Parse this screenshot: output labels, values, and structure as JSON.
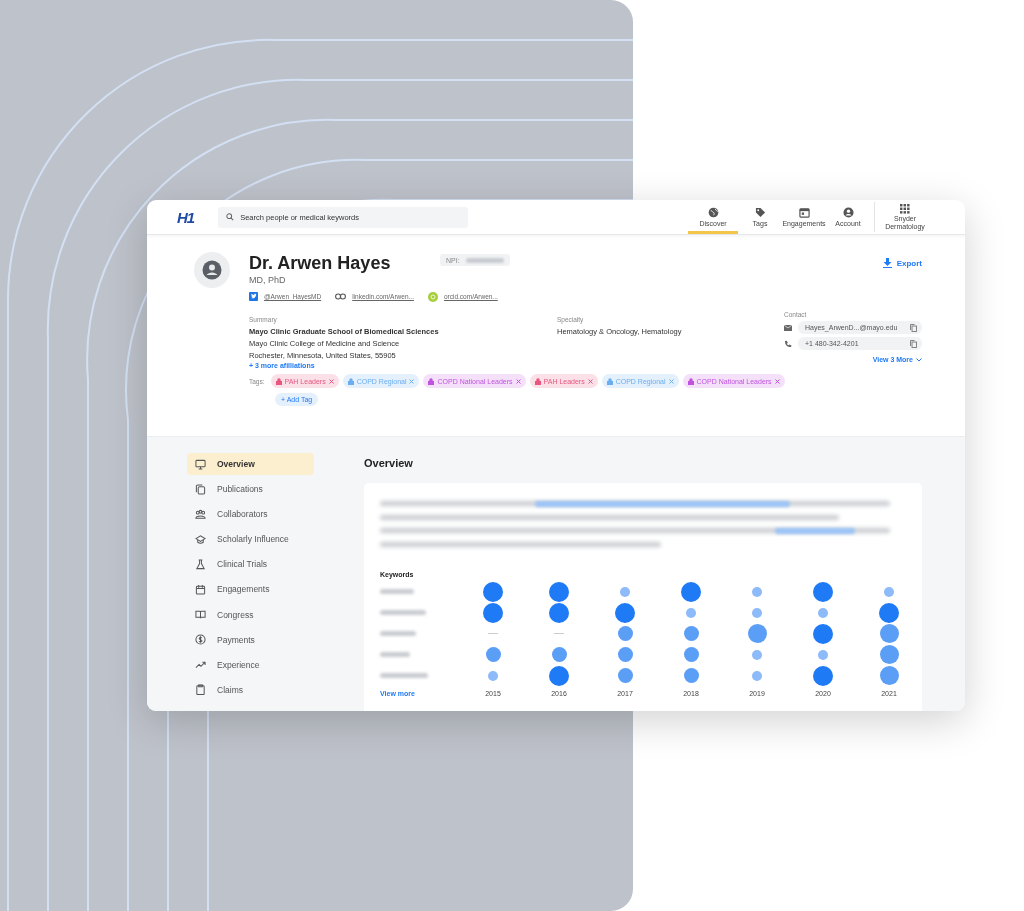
{
  "header": {
    "logo": "H1",
    "search": {
      "placeholder": "Search people or medical keywords"
    },
    "nav": [
      {
        "label": "Discover",
        "selected": true
      },
      {
        "label": "Tags",
        "selected": false
      },
      {
        "label": "Engagements",
        "selected": false
      },
      {
        "label": "Account",
        "selected": false
      }
    ],
    "workspace": "Snyder Dermatology"
  },
  "profile": {
    "name": "Dr. Arwen Hayes",
    "degrees": "MD, PhD",
    "npi_label": "NPI:",
    "export": "Export",
    "links": [
      {
        "kind": "twitter",
        "text": "@Arwen_HayesMD"
      },
      {
        "kind": "linkedin",
        "text": "linkedin.com/Arwen..."
      },
      {
        "kind": "orcid",
        "text": "orcid.com/Arwen..."
      }
    ],
    "summary": {
      "label": "Summary",
      "lines": [
        "Mayo Clinic Graduate School of Biomedical Sciences",
        "Mayo Clinic College of Medicine and Science",
        "Rochester, Minnesota, United States, 55905"
      ],
      "more": "+ 3 more afilliations"
    },
    "specialty": {
      "label": "Specialty",
      "value": "Hematology & Oncology, Hematology"
    },
    "contact": {
      "label": "Contact",
      "items": [
        {
          "kind": "email",
          "value": "Hayes_ArwenD...@mayo.edu"
        },
        {
          "kind": "phone",
          "value": "+1 480-342-4201"
        }
      ],
      "more": "View 3 More"
    },
    "tags_label": "Tags:",
    "tags": [
      {
        "label": "PAH Leaders",
        "color": "#e8557f"
      },
      {
        "label": "COPD Regional",
        "color": "#6aaef0"
      },
      {
        "label": "COPD National Leaders",
        "color": "#c052e0"
      },
      {
        "label": "PAH Leaders",
        "color": "#e8557f"
      },
      {
        "label": "COPD Regional",
        "color": "#6aaef0"
      },
      {
        "label": "COPD National Leaders",
        "color": "#c052e0"
      }
    ],
    "add_tag": "+ Add Tag"
  },
  "sidebar": {
    "items": [
      {
        "label": "Overview",
        "selected": true
      },
      {
        "label": "Publications",
        "selected": false
      },
      {
        "label": "Collaborators",
        "selected": false
      },
      {
        "label": "Scholarly Influence",
        "selected": false
      },
      {
        "label": "Clinical Trials",
        "selected": false
      },
      {
        "label": "Engagements",
        "selected": false
      },
      {
        "label": "Congress",
        "selected": false
      },
      {
        "label": "Payments",
        "selected": false
      },
      {
        "label": "Experience",
        "selected": false
      },
      {
        "label": "Claims",
        "selected": false
      }
    ]
  },
  "overview": {
    "title": "Overview",
    "keywords_title": "Keywords",
    "years": [
      "2015",
      "2016",
      "2017",
      "2018",
      "2019",
      "2020",
      "2021"
    ],
    "view_more": "View more"
  }
}
